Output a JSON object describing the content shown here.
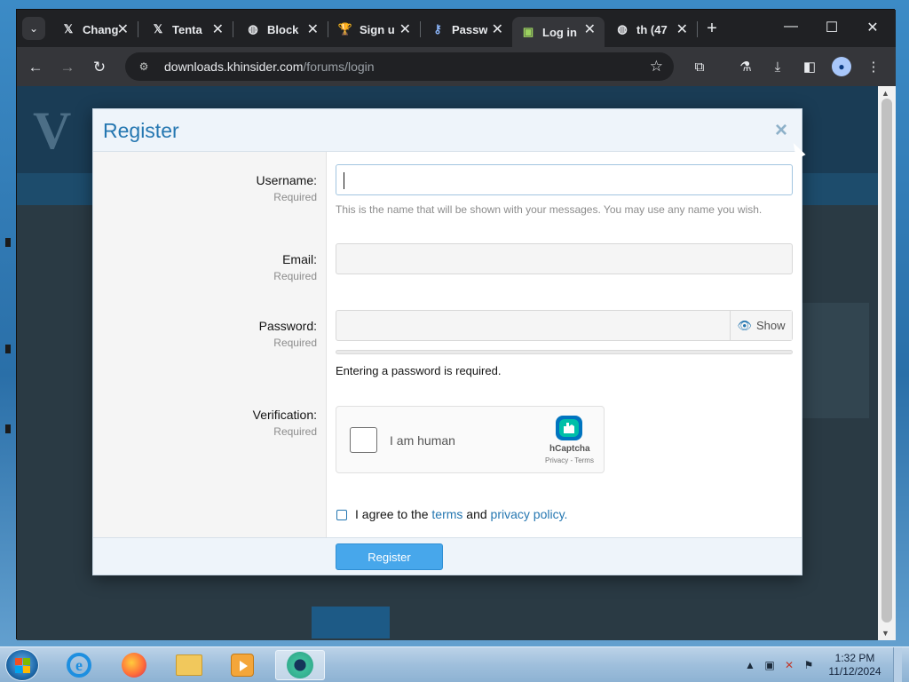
{
  "browser": {
    "tabs": [
      {
        "label": "Chang",
        "icon": "x-logo-icon",
        "icon_glyph": "𝕏",
        "active": false
      },
      {
        "label": "Tenta",
        "icon": "x-logo-icon",
        "icon_glyph": "𝕏",
        "active": false
      },
      {
        "label": "Block",
        "icon": "globe-icon",
        "icon_glyph": "◍",
        "active": false
      },
      {
        "label": "Sign u",
        "icon": "trophy-icon",
        "icon_glyph": "🏆",
        "active": false
      },
      {
        "label": "Passw",
        "icon": "key-icon",
        "icon_glyph": "⚷",
        "active": false
      },
      {
        "label": "Log in",
        "icon": "site-favicon-icon",
        "icon_glyph": "▣",
        "active": true
      },
      {
        "label": "th (47",
        "icon": "globe-icon",
        "icon_glyph": "◍",
        "active": false
      }
    ],
    "url_host": "downloads.khinsider.com",
    "url_path": "/forums/login"
  },
  "modal": {
    "title": "Register",
    "close": "×",
    "fields": {
      "username": {
        "label": "Username:",
        "required": "Required",
        "value": "",
        "hint": "This is the name that will be shown with your messages. You may use any name you wish."
      },
      "email": {
        "label": "Email:",
        "required": "Required",
        "value": ""
      },
      "password": {
        "label": "Password:",
        "required": "Required",
        "value": "",
        "show_label": "Show",
        "note": "Entering a password is required."
      },
      "verification": {
        "label": "Verification:",
        "required": "Required"
      }
    },
    "captcha": {
      "text": "I am human",
      "brand": "hCaptcha",
      "links": "Privacy - Terms"
    },
    "agree": {
      "prefix": "I agree to the ",
      "terms": "terms",
      "middle": " and ",
      "privacy": "privacy policy",
      "suffix": "."
    },
    "submit": "Register"
  },
  "taskbar": {
    "time": "1:32 PM",
    "date": "11/12/2024"
  },
  "colors": {
    "accent": "#2577b1",
    "button": "#47a7eb"
  }
}
